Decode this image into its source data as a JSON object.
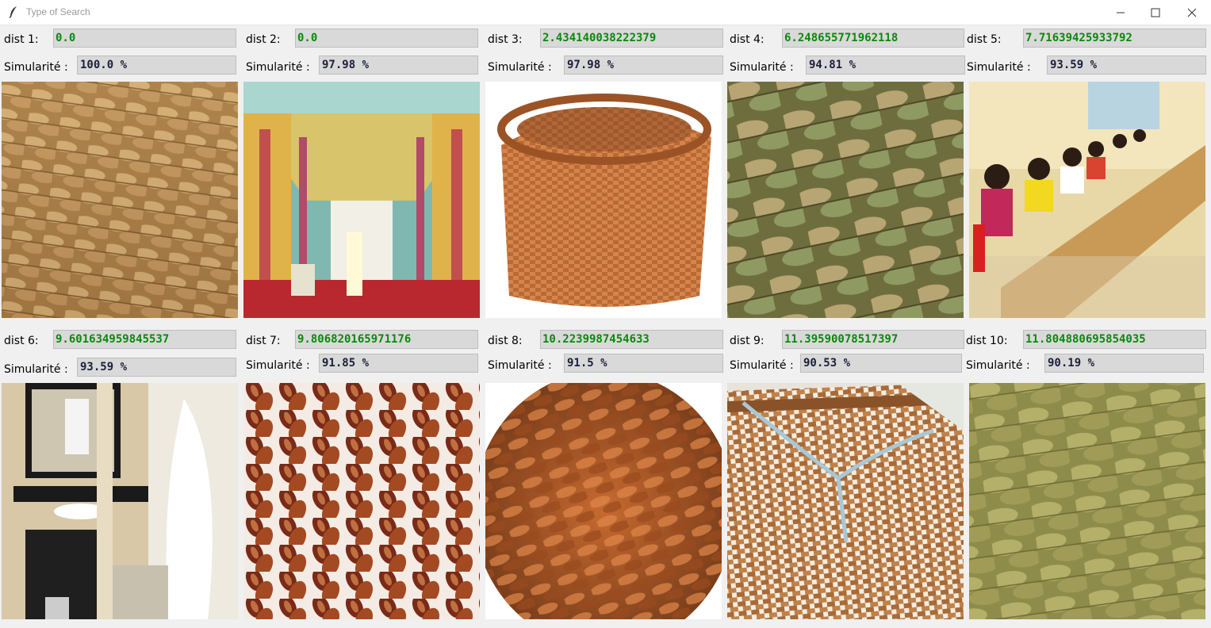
{
  "window": {
    "title": "Type of Search",
    "controls": [
      "minimize-icon",
      "maximize-icon",
      "close-icon"
    ]
  },
  "results": [
    {
      "dist_label": "dist 1:",
      "dist": "0.0",
      "sim_label": "Simularité :",
      "sim": "100.0 %",
      "image": "braided-straw-closeup"
    },
    {
      "dist_label": "dist 2:",
      "dist": "0.0",
      "sim_label": "Simularité :",
      "sim": "97.98 %",
      "image": "temple-interior"
    },
    {
      "dist_label": "dist 3:",
      "dist": "2.434140038222379",
      "sim_label": "Simularité :",
      "sim": "97.98 %",
      "image": "wicker-basket"
    },
    {
      "dist_label": "dist 4:",
      "dist": "6.248655771962118",
      "sim_label": "Simularité :",
      "sim": "94.81 %",
      "image": "green-braided-leaves"
    },
    {
      "dist_label": "dist 5:",
      "dist": "7.71639425933792",
      "sim_label": "Simularité :",
      "sim": "93.59 %",
      "image": "children-in-classroom"
    },
    {
      "dist_label": "dist 6:",
      "dist": "9.601634959845537",
      "sim_label": "Simularité :",
      "sim": "93.59 %",
      "image": "hotel-bathroom"
    },
    {
      "dist_label": "dist 7:",
      "dist": "9.806820165971176",
      "sim_label": "Simularité :",
      "sim": "91.85 %",
      "image": "dark-braided-strands"
    },
    {
      "dist_label": "dist 8:",
      "dist": "10.2239987454633",
      "sim_label": "Simularité :",
      "sim": "91.5 %",
      "image": "braided-hair"
    },
    {
      "dist_label": "dist 9:",
      "dist": "11.39590078517397",
      "sim_label": "Simularité :",
      "sim": "90.53 %",
      "image": "wicker-basket-ribbon"
    },
    {
      "dist_label": "dist 10:",
      "dist": "11.804880695854035",
      "sim_label": "Simularité :",
      "sim": "90.19 %",
      "image": "green-felt-braid"
    }
  ],
  "colors": {
    "dist_text": "#0a8a0a",
    "sim_text": "#1a1f3a",
    "field_bg": "#d9d9d9",
    "window_bg": "#f0f0f0"
  }
}
